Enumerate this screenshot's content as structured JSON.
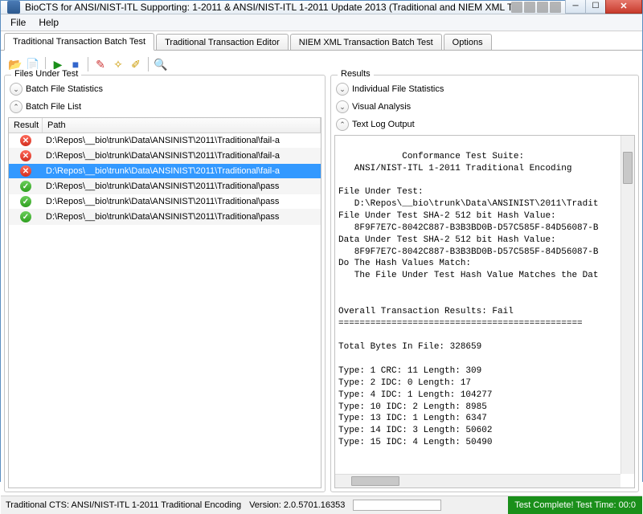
{
  "window": {
    "title": "BioCTS for ANSI/NIST-ITL Supporting: 1-2011 & ANSI/NIST-ITL 1-2011 Update 2013 (Traditional and NIEM XML Transactio..."
  },
  "menu": {
    "file": "File",
    "help": "Help"
  },
  "tabs": {
    "batch": "Traditional Transaction Batch Test",
    "editor": "Traditional Transaction Editor",
    "niem": "NIEM XML Transaction Batch Test",
    "options": "Options",
    "active": "batch"
  },
  "leftGroup": {
    "title": "Files Under Test",
    "section_stats": "Batch File Statistics",
    "section_list": "Batch File List",
    "col_result": "Result",
    "col_path": "Path",
    "rows": [
      {
        "status": "fail",
        "selected": false,
        "path": "D:\\Repos\\__bio\\trunk\\Data\\ANSINIST\\2011\\Traditional\\fail-a"
      },
      {
        "status": "fail",
        "selected": false,
        "path": "D:\\Repos\\__bio\\trunk\\Data\\ANSINIST\\2011\\Traditional\\fail-a"
      },
      {
        "status": "fail",
        "selected": true,
        "path": "D:\\Repos\\__bio\\trunk\\Data\\ANSINIST\\2011\\Traditional\\fail-a"
      },
      {
        "status": "pass",
        "selected": false,
        "path": "D:\\Repos\\__bio\\trunk\\Data\\ANSINIST\\2011\\Traditional\\pass"
      },
      {
        "status": "pass",
        "selected": false,
        "path": "D:\\Repos\\__bio\\trunk\\Data\\ANSINIST\\2011\\Traditional\\pass"
      },
      {
        "status": "pass",
        "selected": false,
        "path": "D:\\Repos\\__bio\\trunk\\Data\\ANSINIST\\2011\\Traditional\\pass"
      }
    ]
  },
  "rightGroup": {
    "title": "Results",
    "section_indiv": "Individual File Statistics",
    "section_visual": "Visual Analysis",
    "section_textlog": "Text Log Output",
    "log": "Conformance Test Suite:\n   ANSI/NIST-ITL 1-2011 Traditional Encoding\n\nFile Under Test:\n   D:\\Repos\\__bio\\trunk\\Data\\ANSINIST\\2011\\Tradit\nFile Under Test SHA-2 512 bit Hash Value:\n   8F9F7E7C-8042C887-B3B3BD0B-D57C585F-84D56087-B\nData Under Test SHA-2 512 bit Hash Value:\n   8F9F7E7C-8042C887-B3B3BD0B-D57C585F-84D56087-B\nDo The Hash Values Match:\n   The File Under Test Hash Value Matches the Dat\n\n\nOverall Transaction Results: Fail\n==============================================\n\nTotal Bytes In File: 328659\n\nType: 1 CRC: 11 Length: 309\nType: 2 IDC: 0 Length: 17\nType: 4 IDC: 1 Length: 104277\nType: 10 IDC: 2 Length: 8985\nType: 13 IDC: 1 Length: 6347\nType: 14 IDC: 3 Length: 50602\nType: 15 IDC: 4 Length: 50490"
  },
  "status": {
    "cts": "Traditional CTS: ANSI/NIST-ITL 1-2011 Traditional Encoding",
    "version": "Version: 2.0.5701.16353",
    "complete": "Test Complete! Test Time: 00:0"
  },
  "icons": {
    "open": "📂",
    "add": "📄",
    "run": "▶",
    "stop": "■",
    "edit": "✎",
    "wand": "✧",
    "brush": "✐",
    "search": "🔍"
  }
}
